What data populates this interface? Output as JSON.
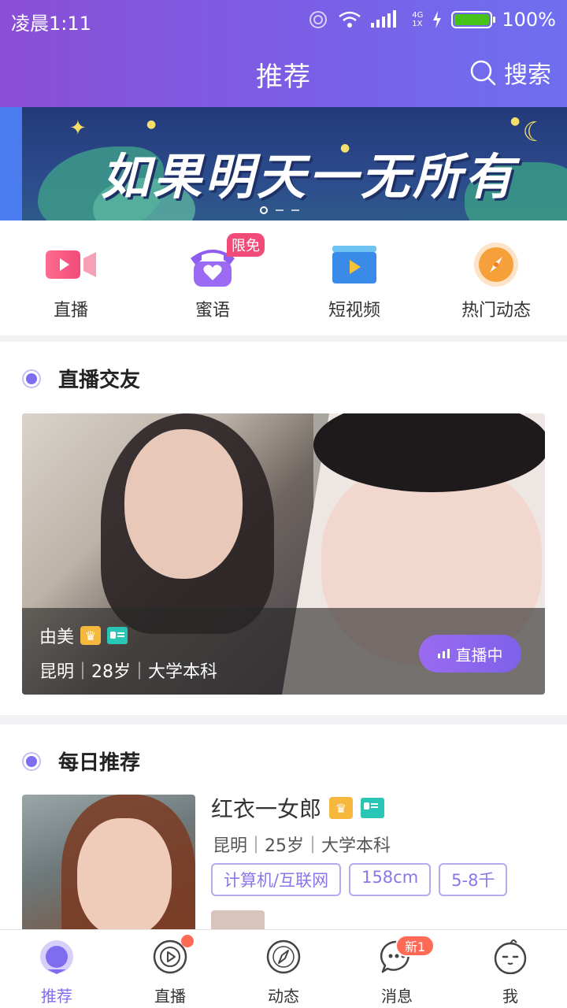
{
  "status": {
    "time": "凌晨1:11",
    "network_top": "4G",
    "network_bottom": "1X",
    "battery": "100%"
  },
  "header": {
    "title": "推荐",
    "search_label": "搜索"
  },
  "banner": {
    "text": "如果明天一无所有",
    "slide_index": 1,
    "slide_count": 3
  },
  "quick_entries": [
    {
      "label": "直播",
      "icon": "video-camera-icon"
    },
    {
      "label": "蜜语",
      "icon": "phone-heart-icon",
      "badge": "限免"
    },
    {
      "label": "短视频",
      "icon": "short-video-icon"
    },
    {
      "label": "热门动态",
      "icon": "compass-icon"
    }
  ],
  "live_section": {
    "title": "直播交友",
    "card": {
      "name": "由美",
      "info": "昆明｜28岁｜大学本科",
      "button": "直播中"
    }
  },
  "daily_section": {
    "title": "每日推荐",
    "card": {
      "name": "红衣一女郎",
      "info": "昆明｜25岁｜大学本科",
      "tags": [
        "计算机/互联网",
        "158cm",
        "5-8千"
      ]
    }
  },
  "tabs": [
    {
      "label": "推荐",
      "icon": "recommend-icon",
      "active": true
    },
    {
      "label": "直播",
      "icon": "play-icon",
      "dot": true
    },
    {
      "label": "动态",
      "icon": "compass-icon"
    },
    {
      "label": "消息",
      "icon": "message-icon",
      "badge": "新1"
    },
    {
      "label": "我",
      "icon": "profile-face-icon"
    }
  ],
  "colors": {
    "accent": "#7f6df0",
    "header_start": "#8a4fd6",
    "header_end": "#6f6ff0",
    "badge_red": "#ff6a57"
  }
}
